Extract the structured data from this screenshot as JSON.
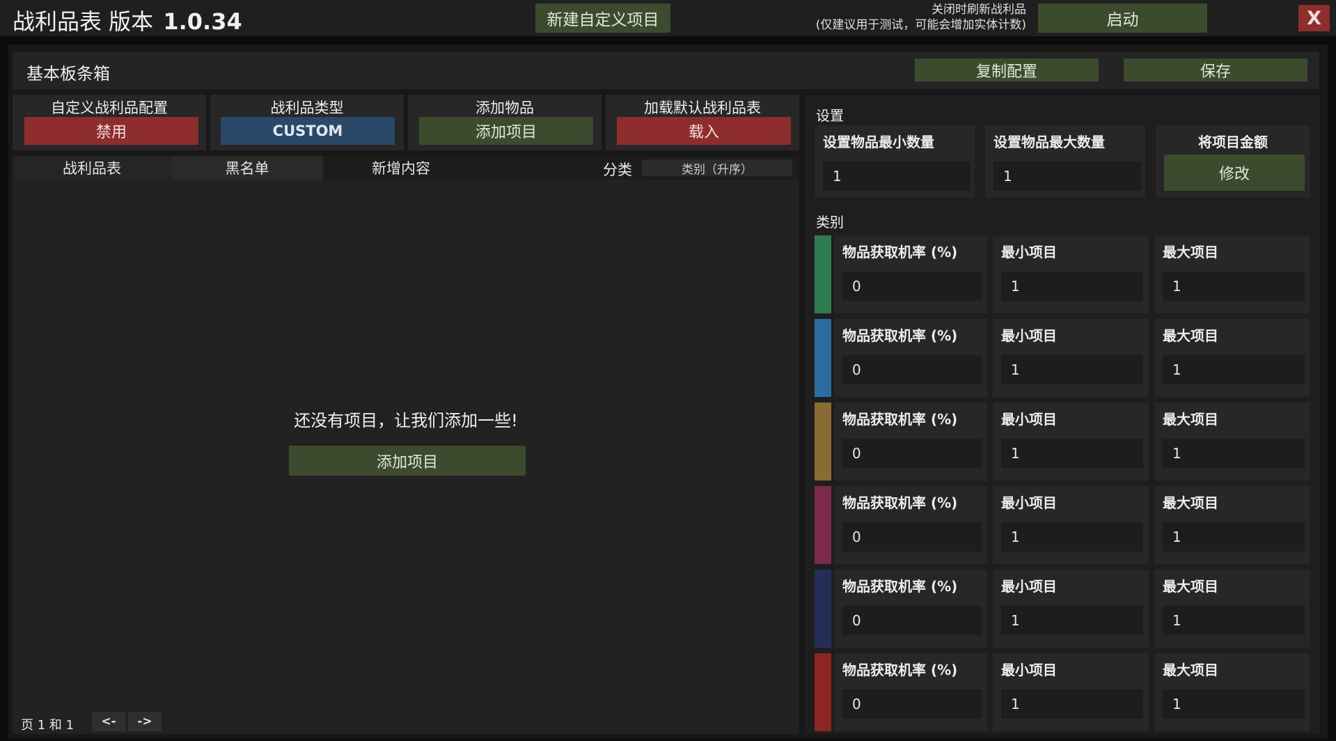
{
  "header": {
    "title": "战利品表 版本",
    "version": "1.0.34",
    "new_item_button": "新建自定义项目",
    "refresh_label_line1": "关闭时刷新战利品",
    "refresh_label_line2": "(仅建议用于测试，可能会增加实体计数)",
    "start_button": "启动",
    "close_button": "X"
  },
  "panel": {
    "name": "基本板条箱",
    "copy_button": "复制配置",
    "save_button": "保存"
  },
  "config_tiles": [
    {
      "label": "自定义战利品配置",
      "button": "禁用"
    },
    {
      "label": "战利品类型",
      "button": "CUSTOM"
    },
    {
      "label": "添加物品",
      "button": "添加项目"
    },
    {
      "label": "加载默认战利品表",
      "button": "载入"
    }
  ],
  "tabs": {
    "loot_table": "战利品表",
    "blacklist": "黑名单",
    "new_content": "新增内容",
    "sort_label": "分类",
    "sort_value": "类别（升序）"
  },
  "empty_state": {
    "message": "还没有项目，让我们添加一些!",
    "add_button": "添加项目"
  },
  "pagination": {
    "page_text": "页 1 和 1",
    "prev": "<-",
    "next": "->"
  },
  "settings": {
    "title": "设置",
    "min_count_label": "设置物品最小数量",
    "min_count_value": "1",
    "max_count_label": "设置物品最大数量",
    "max_count_value": "1",
    "amount_label": "将项目金额",
    "amount_button": "修改"
  },
  "categories": {
    "title": "类别",
    "rows": [
      {
        "color": "#2e7d50",
        "chance_label": "物品获取机率 (%)",
        "chance": "0",
        "min_label": "最小项目",
        "min": "1",
        "max_label": "最大项目",
        "max": "1"
      },
      {
        "color": "#2b6d9e",
        "chance_label": "物品获取机率 (%)",
        "chance": "0",
        "min_label": "最小项目",
        "min": "1",
        "max_label": "最大项目",
        "max": "1"
      },
      {
        "color": "#8a6b33",
        "chance_label": "物品获取机率 (%)",
        "chance": "0",
        "min_label": "最小项目",
        "min": "1",
        "max_label": "最大项目",
        "max": "1"
      },
      {
        "color": "#7b2a4c",
        "chance_label": "物品获取机率 (%)",
        "chance": "0",
        "min_label": "最小项目",
        "min": "1",
        "max_label": "最大项目",
        "max": "1"
      },
      {
        "color": "#252e58",
        "chance_label": "物品获取机率 (%)",
        "chance": "0",
        "min_label": "最小项目",
        "min": "1",
        "max_label": "最大项目",
        "max": "1"
      },
      {
        "color": "#8d2523",
        "chance_label": "物品获取机率 (%)",
        "chance": "0",
        "min_label": "最小项目",
        "min": "1",
        "max_label": "最大项目",
        "max": "1"
      }
    ]
  }
}
